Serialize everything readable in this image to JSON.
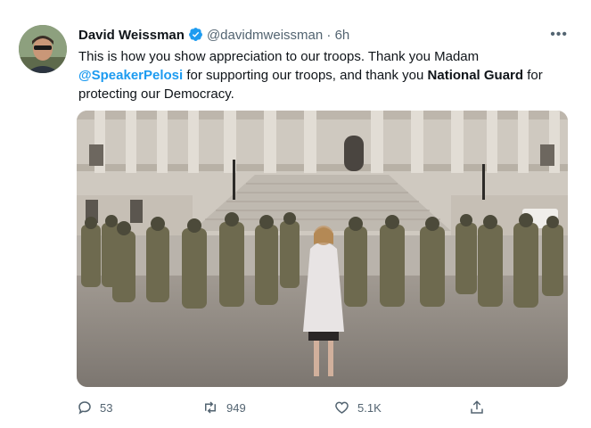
{
  "tweet": {
    "author_name": "David Weissman",
    "handle": "@davidmweissman",
    "separator": "·",
    "time": "6h",
    "more": "•••",
    "text_part1": "This is how you show appreciation to our troops. Thank you Madam ",
    "mention": "@SpeakerPelosi",
    "text_part2": " for supporting our troops, and thank you ",
    "bold_text": "National Guard",
    "text_part3": " for protecting our Democracy."
  },
  "actions": {
    "replies": "53",
    "retweets": "949",
    "likes": "5.1K"
  },
  "icons": {
    "verified": "verified-badge-icon",
    "reply": "reply-icon",
    "retweet": "retweet-icon",
    "like": "heart-icon",
    "share": "share-icon",
    "more": "more-icon"
  },
  "colors": {
    "accent": "#1d9bf0",
    "text": "#0f1419",
    "secondary": "#536471"
  }
}
